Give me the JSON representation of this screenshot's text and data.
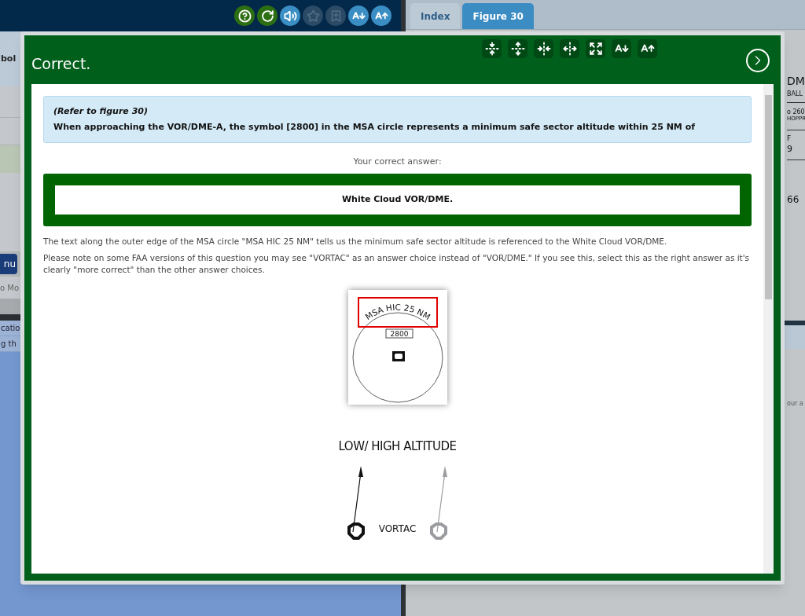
{
  "background": {
    "toolbar": [
      {
        "kind": "help",
        "disabled": false
      },
      {
        "kind": "refresh",
        "disabled": false
      },
      {
        "kind": "sound",
        "disabled": false
      },
      {
        "kind": "star",
        "disabled": true
      },
      {
        "kind": "memo",
        "disabled": true
      },
      {
        "kind": "font_smaller",
        "disabled": false
      },
      {
        "kind": "font_larger",
        "disabled": false
      }
    ],
    "left_pane": {
      "heading_fragment": "bol",
      "menu_button": "nu",
      "row_fragment": "o Mo",
      "list_rows": [
        "catio",
        "g th"
      ]
    },
    "right_pane": {
      "tabs": [
        {
          "label": "Index",
          "selected": false
        },
        {
          "label": "Figure 30",
          "selected": true
        }
      ],
      "chart_fragments": [
        "DM",
        "BALL",
        "o 260",
        "HOPPR",
        "F",
        "9",
        "66"
      ],
      "text_fragment": "our a"
    }
  },
  "modal": {
    "title": "Correct.",
    "tools": [
      {
        "kind": "fit_height"
      },
      {
        "kind": "expand_height"
      },
      {
        "kind": "fit_width"
      },
      {
        "kind": "expand_width"
      },
      {
        "kind": "fullscreen"
      },
      {
        "kind": "font_smaller"
      },
      {
        "kind": "font_larger"
      }
    ],
    "question": {
      "reference": "(Refer to figure 30)",
      "text": "When approaching the VOR/DME-A, the symbol [2800] in the MSA circle represents a minimum safe sector altitude within 25 NM of"
    },
    "answer_label": "Your correct answer:",
    "answer": "White Cloud VOR/DME.",
    "explanation": [
      "The text along the outer edge of the MSA circle \"MSA HIC 25 NM\" tells us the minimum safe sector altitude is referenced to the White Cloud VOR/DME.",
      "Please note on some FAA versions of this question you may see \"VORTAC\" as an answer choice instead of \"VOR/DME.\" If you see this, select this as the right answer as it's clearly \"more correct\" than the other answer choices."
    ],
    "figure": {
      "msa_label": "MSA HIC 25 NM",
      "altitude": "2800",
      "legend_title": "LOW/ HIGH ALTITUDE",
      "symbol_label": "VORTAC"
    }
  }
}
